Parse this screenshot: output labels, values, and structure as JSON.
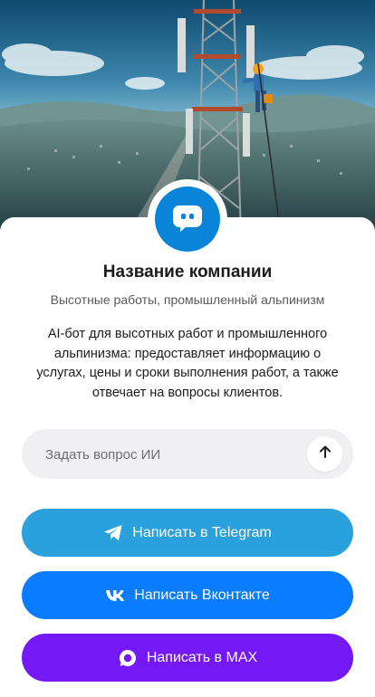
{
  "company": {
    "name": "Название компании",
    "subtitle": "Высотные работы, промышленный альпинизм",
    "description": "AI-бот для высотных работ и промышленного альпинизма: предоставляет информацию о услугах, цены и сроки выполнения работ, а также отвечает на вопросы клиентов."
  },
  "chat": {
    "placeholder": "Задать вопрос ИИ",
    "send_icon": "arrow-up-icon"
  },
  "buttons": {
    "telegram": {
      "label": "Написать в Telegram",
      "icon": "telegram-icon",
      "color": "#2aa1dc"
    },
    "vk": {
      "label": "Написать Вконтакте",
      "icon": "vk-icon",
      "color": "#0a7cff"
    },
    "max": {
      "label": "Написать в MAX",
      "icon": "max-icon",
      "color": "#7419f5"
    }
  },
  "colors": {
    "avatar": "#0a84d9",
    "input_background": "#f0f0f2"
  },
  "hero": {
    "image": "industrial climber on telecom tower above landscape"
  }
}
